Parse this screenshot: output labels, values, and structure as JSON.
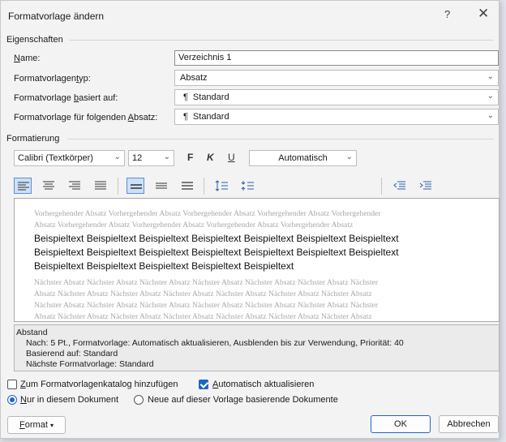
{
  "window": {
    "title": "Formatvorlage ändern",
    "help": "?",
    "close": "✕"
  },
  "properties": {
    "section": "Eigenschaften",
    "name_label": "Name:",
    "name_value": "Verzeichnis 1",
    "type_label": "Formatvorlagentyp:",
    "type_value": "Absatz",
    "based_label": "Formatvorlage basiert auf:",
    "based_value": "Standard",
    "next_label": "Formatvorlage für folgenden Absatz:",
    "next_value": "Standard",
    "para_mark": "¶"
  },
  "formatting": {
    "section": "Formatierung",
    "font": "Calibri (Textkörper)",
    "size": "12",
    "bold": "F",
    "italic": "K",
    "underline": "U",
    "color": "Automatisch"
  },
  "preview": {
    "previous_lines": [
      "Vorhergehender Absatz Vorhergehender Absatz Vorhergehender Absatz Vorhergehender Absatz Vorhergehender",
      "Absatz Vorhergehender Absatz Vorhergehender Absatz Vorhergehender Absatz Vorhergehender Absatz"
    ],
    "sample_lines": [
      "Beispieltext Beispieltext Beispieltext Beispieltext Beispieltext Beispieltext Beispieltext",
      "Beispieltext Beispieltext Beispieltext Beispieltext Beispieltext Beispieltext Beispieltext",
      "Beispieltext Beispieltext Beispieltext Beispieltext Beispieltext"
    ],
    "next_lines": [
      "Nächster Absatz Nächster Absatz Nächster Absatz Nächster Absatz Nächster Absatz Nächster Absatz Nächster",
      "Absatz Nächster Absatz Nächster Absatz Nächster Absatz Nächster Absatz Nächster Absatz Nächster Absatz",
      "Nächster Absatz Nächster Absatz Nächster Absatz Nächster Absatz Nächster Absatz Nächster Absatz Nächster",
      "Absatz Nächster Absatz Nächster Absatz Nächster Absatz Nächster Absatz Nächster Absatz Nächster Absatz"
    ]
  },
  "description": {
    "heading": "Abstand",
    "line1": "Nach:  5 Pt., Formatvorlage: Automatisch aktualisieren, Ausblenden bis zur Verwendung, Priorität: 40",
    "line2": "Basierend auf: Standard",
    "line3": "Nächste Formatvorlage: Standard"
  },
  "options": {
    "add_to_gallery": "Zum Formatvorlagenkatalog hinzufügen",
    "add_to_gallery_checked": false,
    "auto_update": "Automatisch aktualisieren",
    "auto_update_checked": true,
    "only_this_document": "Nur in diesem Dokument",
    "new_documents": "Neue auf dieser Vorlage basierende Dokumente"
  },
  "buttons": {
    "format": "Format",
    "ok": "OK",
    "cancel": "Abbrechen"
  },
  "colors": {
    "accent": "#1b66c9",
    "active_toolbar": "#cde0f7"
  }
}
